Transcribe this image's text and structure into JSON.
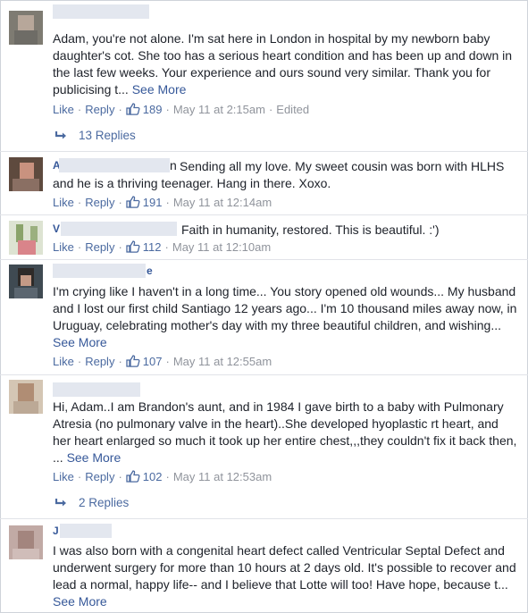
{
  "ui": {
    "like": "Like",
    "reply": "Reply",
    "dot": "·"
  },
  "comments": [
    {
      "name_visible": "",
      "text": "Adam, you're not alone. I'm sat here in London in hospital by my newborn baby daughter's cot. She too has a serious heart condition and has been up and down in the last few weeks. Your experience and ours sound very similar. Thank you for publicising t...",
      "see_more": "See More",
      "likes": "189",
      "time": "May 11 at 2:15am",
      "edited": "Edited",
      "replies": "13 Replies"
    },
    {
      "name_visible": "A",
      "name_tail": "n",
      "text": "Sending all my love. My sweet cousin was born with HLHS and he is a thriving teenager. Hang in there. Xoxo.",
      "likes": "191",
      "time": "May 11 at 12:14am"
    },
    {
      "name_visible": "V",
      "text": "Faith in humanity, restored. This is beautiful. :')",
      "likes": "112",
      "time": "May 11 at 12:10am"
    },
    {
      "name_visible": "",
      "name_tail": "e",
      "text": "I'm crying like I haven't in a long time... You story opened old wounds... My husband and I lost our first child Santiago 12 years ago... I'm 10 thousand miles away now, in Uruguay, celebrating mother's day with my three beautiful children, and wishing...",
      "see_more": "See More",
      "likes": "107",
      "time": "May 11 at 12:55am"
    },
    {
      "name_visible": "",
      "text": "Hi, Adam..I am Brandon's aunt, and in 1984 I gave birth to a baby with Pulmonary Atresia (no pulmonary valve in the heart)..She developed hyoplastic rt heart, and her heart enlarged so much it took up her entire chest,,,they couldn't fix it back then,",
      "text_after": "...",
      "see_more": "See More",
      "likes": "102",
      "time": "May 11 at 12:53am",
      "replies": "2 Replies"
    },
    {
      "name_visible": "J",
      "text": "I was also born with a congenital heart defect called Ventricular Septal Defect and underwent surgery for more than 10 hours at 2 days old. It's possible to recover and lead a normal, happy life-- and I believe that Lotte will too! Have hope, because t...",
      "see_more": "See More"
    }
  ],
  "colors": {
    "link": "#4b6aa0",
    "meta": "#90949c",
    "text": "#1d2129",
    "name_blur": "#e3e7ef"
  }
}
